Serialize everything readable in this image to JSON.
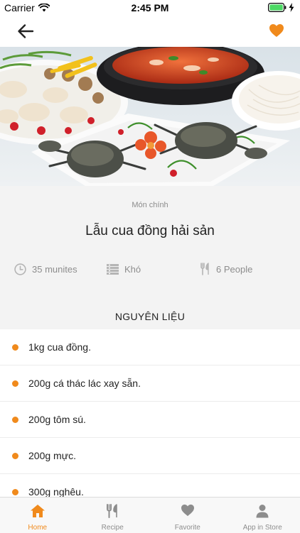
{
  "status_bar": {
    "carrier": "Carrier",
    "time": "2:45 PM"
  },
  "nav": {
    "back_icon": "arrow-left-icon",
    "favorite_icon": "heart-icon",
    "accent_color": "#f08a1c"
  },
  "recipe": {
    "category": "Món chính",
    "title": "Lẫu cua đồng hải sản",
    "time": "35 munites",
    "difficulty": "Khó",
    "servings": "6 People"
  },
  "ingredients_section": {
    "title": "NGUYÊN LIỆU",
    "items": [
      "1kg cua đồng.",
      "200g cá thác lác xay sẵn.",
      "200g tôm sú.",
      "200g mực.",
      "300g nghêu."
    ]
  },
  "tabs": [
    {
      "label": "Home",
      "icon": "home-icon",
      "active": true
    },
    {
      "label": "Recipe",
      "icon": "fork-knife-icon",
      "active": false
    },
    {
      "label": "Favorite",
      "icon": "heart-icon",
      "active": false
    },
    {
      "label": "App in Store",
      "icon": "person-icon",
      "active": false
    }
  ]
}
